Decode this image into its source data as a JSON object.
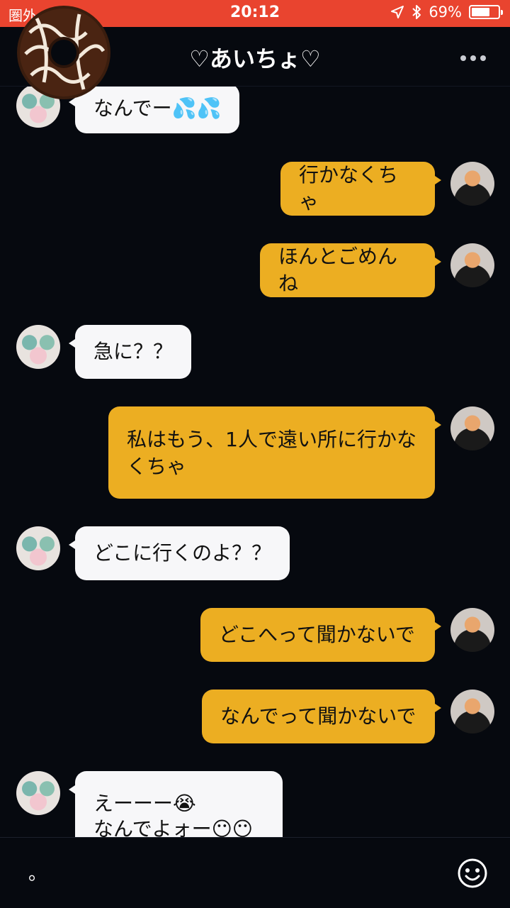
{
  "status_bar": {
    "carrier": "圏外",
    "time": "20:12",
    "battery": "69%",
    "battery_level": 0.69,
    "icons": [
      "location-arrow-icon",
      "bluetooth-icon",
      "battery-icon"
    ]
  },
  "header": {
    "title": "♡あいちょ♡",
    "more_icon": "more-dots-icon"
  },
  "messages": [
    {
      "sender": "them",
      "text": "なんでー💦💦"
    },
    {
      "sender": "me",
      "text": "行かなくちゃ"
    },
    {
      "sender": "me",
      "text": "ほんとごめんね"
    },
    {
      "sender": "them",
      "text": "急に？？"
    },
    {
      "sender": "me",
      "text": "私はもう、1人で遠い所に行かなくちゃ"
    },
    {
      "sender": "them",
      "text": "どこに行くのよ？？"
    },
    {
      "sender": "me",
      "text": "どこへって聞かないで"
    },
    {
      "sender": "me",
      "text": "なんでって聞かないで"
    },
    {
      "sender": "them",
      "text": "えーーー😭\nなんでよォー😶😶"
    }
  ],
  "input": {
    "value": "。",
    "emoji_icon": "smiley-icon"
  },
  "colors": {
    "status_bar": "#e9442f",
    "background": "#06090f",
    "my_bubble": "#ecae22",
    "their_bubble": "#f7f7f9"
  }
}
